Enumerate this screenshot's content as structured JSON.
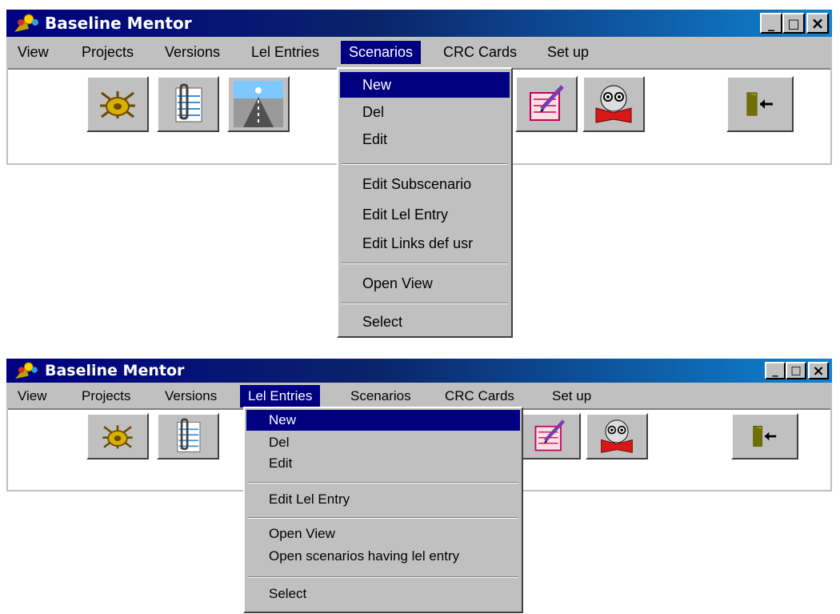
{
  "window1": {
    "title": "Baseline Mentor",
    "controls": {
      "minimize": "_",
      "maximize": "□",
      "close": "×"
    },
    "menu": [
      {
        "label": "View"
      },
      {
        "label": "Projects"
      },
      {
        "label": "Versions"
      },
      {
        "label": "Lel Entries"
      },
      {
        "label": "Scenarios"
      },
      {
        "label": "CRC Cards"
      },
      {
        "label": "Set up"
      }
    ],
    "open_menu": "Scenarios",
    "toolbar_icons": [
      "ship-wheel-icon",
      "paperclip-notebook-icon",
      "runway-icon",
      "notepad-pencil-icon",
      "face-book-icon",
      "exit-door-icon"
    ],
    "dropdown": [
      {
        "label": "New"
      },
      {
        "label": "Del"
      },
      {
        "label": "Edit"
      },
      {
        "label": "Edit Subscenario"
      },
      {
        "label": "Edit Lel Entry"
      },
      {
        "label": "Edit Links def usr"
      },
      {
        "label": "Open View"
      },
      {
        "label": "Select"
      }
    ]
  },
  "window2": {
    "title": "Baseline Mentor",
    "controls": {
      "minimize": "_",
      "maximize": "□",
      "close": "×"
    },
    "menu": [
      {
        "label": "View"
      },
      {
        "label": "Projects"
      },
      {
        "label": "Versions"
      },
      {
        "label": "Lel Entries"
      },
      {
        "label": "Scenarios"
      },
      {
        "label": "CRC Cards"
      },
      {
        "label": "Set up"
      }
    ],
    "open_menu": "Lel Entries",
    "toolbar_icons": [
      "ship-wheel-icon",
      "paperclip-notebook-icon",
      "notepad-pencil-icon",
      "face-book-icon",
      "exit-door-icon"
    ],
    "dropdown": [
      {
        "label": "New"
      },
      {
        "label": "Del"
      },
      {
        "label": "Edit"
      },
      {
        "label": "Edit Lel Entry"
      },
      {
        "label": "Open View"
      },
      {
        "label": "Open scenarios having lel entry"
      },
      {
        "label": "Select"
      }
    ]
  },
  "colors": {
    "title_gradient_start": "#000080",
    "title_gradient_end": "#1084d0",
    "menu_highlight": "#000080",
    "chrome": "#c0c0c0"
  }
}
